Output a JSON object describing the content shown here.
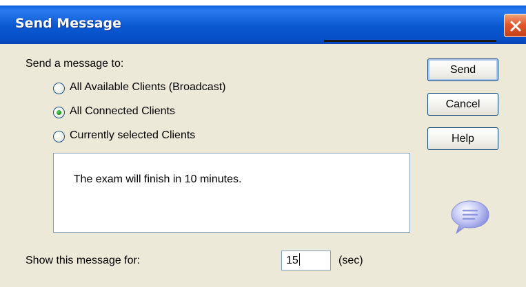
{
  "window": {
    "title": "Send Message"
  },
  "recipients": {
    "heading": "Send a message to:",
    "options": [
      {
        "label": "All Available Clients (Broadcast)",
        "selected": false
      },
      {
        "label": "All Connected Clients",
        "selected": true
      },
      {
        "label": "Currently selected Clients",
        "selected": false
      }
    ]
  },
  "message": {
    "text": "The exam will finish in 10 minutes."
  },
  "duration": {
    "label": "Show this message for:",
    "value": "15",
    "unit": "(sec)"
  },
  "buttons": {
    "send": "Send",
    "cancel": "Cancel",
    "help": "Help"
  },
  "icons": {
    "close": "close-icon",
    "bubble": "speech-bubble-icon"
  },
  "colors": {
    "titlebar": "#0a58d0",
    "dialog_bg": "#ece9d8",
    "close_button": "#e2582e",
    "radio_selected": "#1f9a1f"
  }
}
